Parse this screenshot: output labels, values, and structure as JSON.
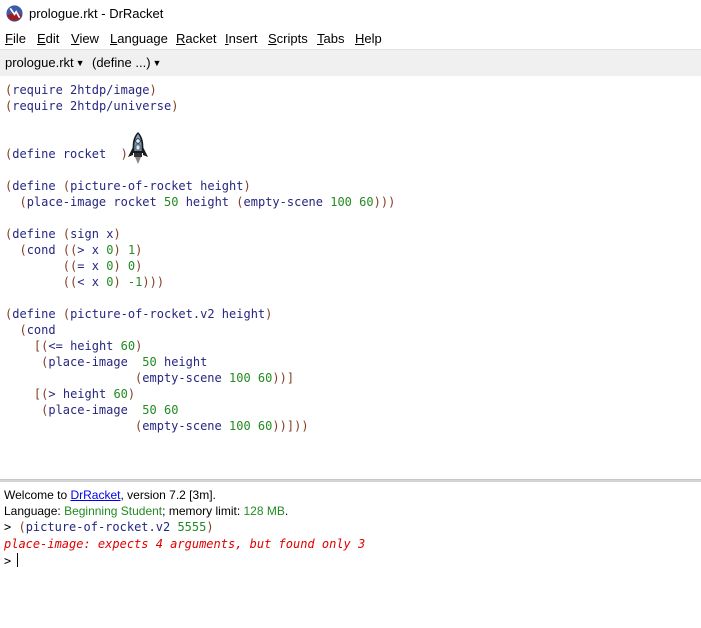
{
  "window": {
    "title": "prologue.rkt - DrRacket"
  },
  "menu": [
    {
      "mn": "F",
      "rest": "ile"
    },
    {
      "mn": "E",
      "rest": "dit"
    },
    {
      "mn": "V",
      "rest": "iew"
    },
    {
      "mn": "L",
      "rest": "anguage"
    },
    {
      "mn": "R",
      "rest": "acket"
    },
    {
      "mn": "I",
      "rest": "nsert"
    },
    {
      "mn": "S",
      "rest": "cripts"
    },
    {
      "mn": "T",
      "rest": "abs"
    },
    {
      "mn": "H",
      "rest": "elp"
    }
  ],
  "toolbar": {
    "file_label": "prologue.rkt",
    "define_label": "(define ...)"
  },
  "editor": {
    "code_lines": [
      "(require 2htdp/image)",
      "(require 2htdp/universe)",
      "",
      "",
      "(define rocket  )",
      "",
      "(define (picture-of-rocket height)",
      "  (place-image rocket 50 height (empty-scene 100 60)))",
      "",
      "(define (sign x)",
      "  (cond ((> x 0) 1)",
      "        ((= x 0) 0)",
      "        ((< x 0) -1)))",
      "",
      "(define (picture-of-rocket.v2 height)",
      "  (cond",
      "    [(<= height 60)",
      "     (place-image  50 height",
      "                  (empty-scene 100 60))]",
      "    [(> height 60)",
      "     (place-image  50 60",
      "                  (empty-scene 100 60))]))"
    ]
  },
  "repl": {
    "welcome_prefix": "Welcome to ",
    "welcome_link": "DrRacket",
    "welcome_suffix": ", version 7.2 [3m].",
    "lang_prefix": "Language: ",
    "lang_name": "Beginning Student",
    "lang_mid": "; memory limit: ",
    "lang_mem": "128 MB",
    "lang_end": ".",
    "prompt": ">",
    "input": "(picture-of-rocket.v2 5555)",
    "error": "place-image: expects 4 arguments, but found only 3"
  },
  "colors": {
    "paren": "#843c24",
    "keyword": "#262680",
    "number": "#228b22",
    "error": "#e00000",
    "link": "#0000ee"
  }
}
